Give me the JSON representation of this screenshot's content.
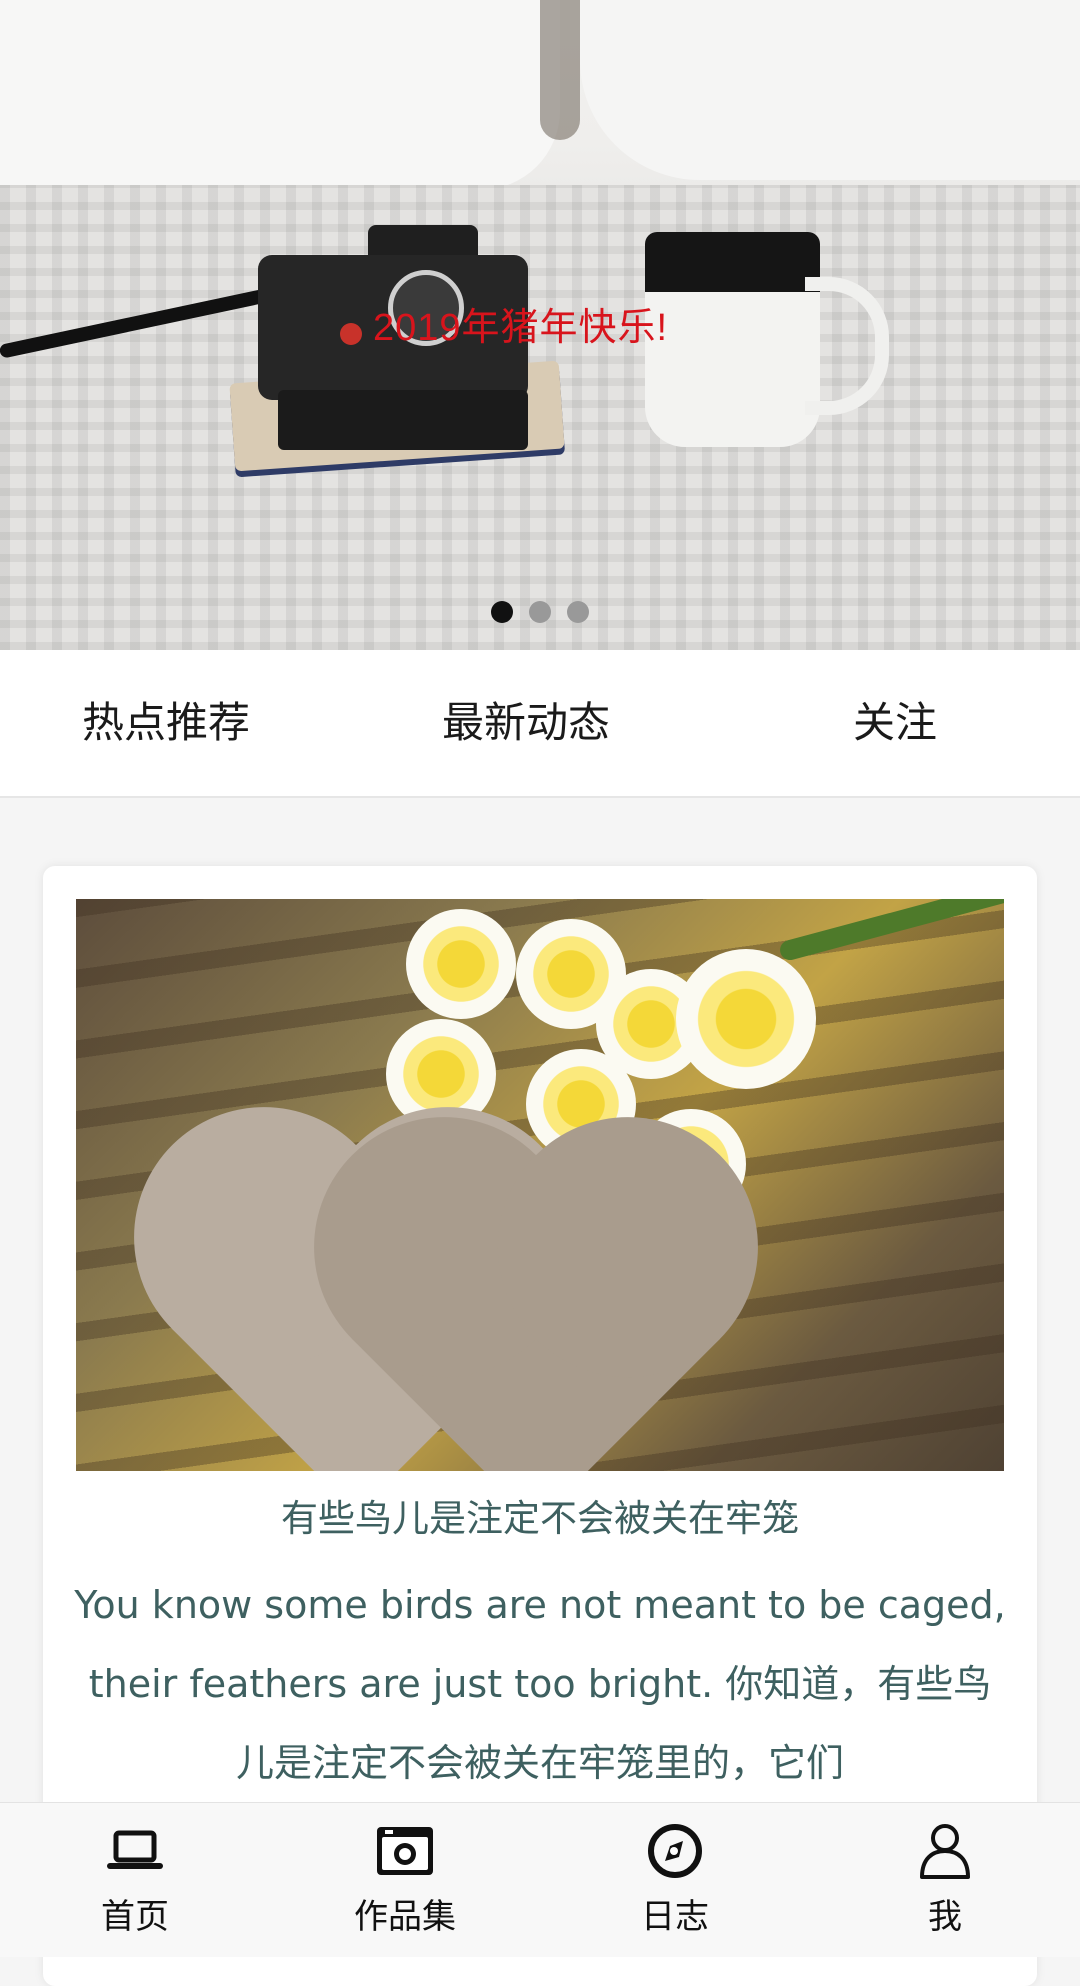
{
  "banner": {
    "caption": "2019年猪年快乐!",
    "dots_total": 3,
    "active_dot": 1
  },
  "tabs": [
    {
      "label": "热点推荐"
    },
    {
      "label": "最新动态"
    },
    {
      "label": "关注"
    }
  ],
  "card": {
    "title": "有些鸟儿是注定不会被关在牢笼",
    "body": "You know some birds are not meant to be caged, their feathers are just too bright. 你知道，有些鸟儿是注定不会被关在牢笼里的，它们"
  },
  "bottom_nav": [
    {
      "label": "首页",
      "icon": "laptop-icon"
    },
    {
      "label": "作品集",
      "icon": "camera-icon"
    },
    {
      "label": "日志",
      "icon": "compass-icon"
    },
    {
      "label": "我",
      "icon": "user-icon"
    }
  ],
  "colors": {
    "caption_red": "#d8141c",
    "card_text": "#3e6060",
    "active_dot": "#111111",
    "inactive_dot": "#999999"
  }
}
